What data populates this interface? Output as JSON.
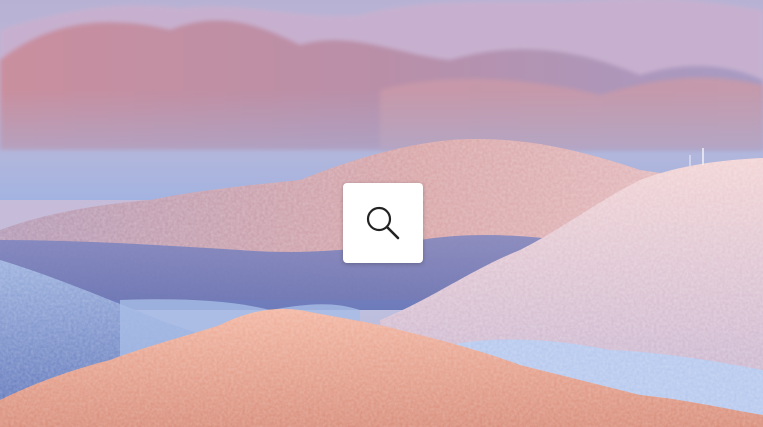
{
  "image": {
    "subject": "frost-covered-mountains-at-sunrise"
  },
  "zoom_button": {
    "icon": "magnifier-icon"
  },
  "colors": {
    "button_bg": "#ffffff",
    "icon_stroke": "#222222"
  }
}
